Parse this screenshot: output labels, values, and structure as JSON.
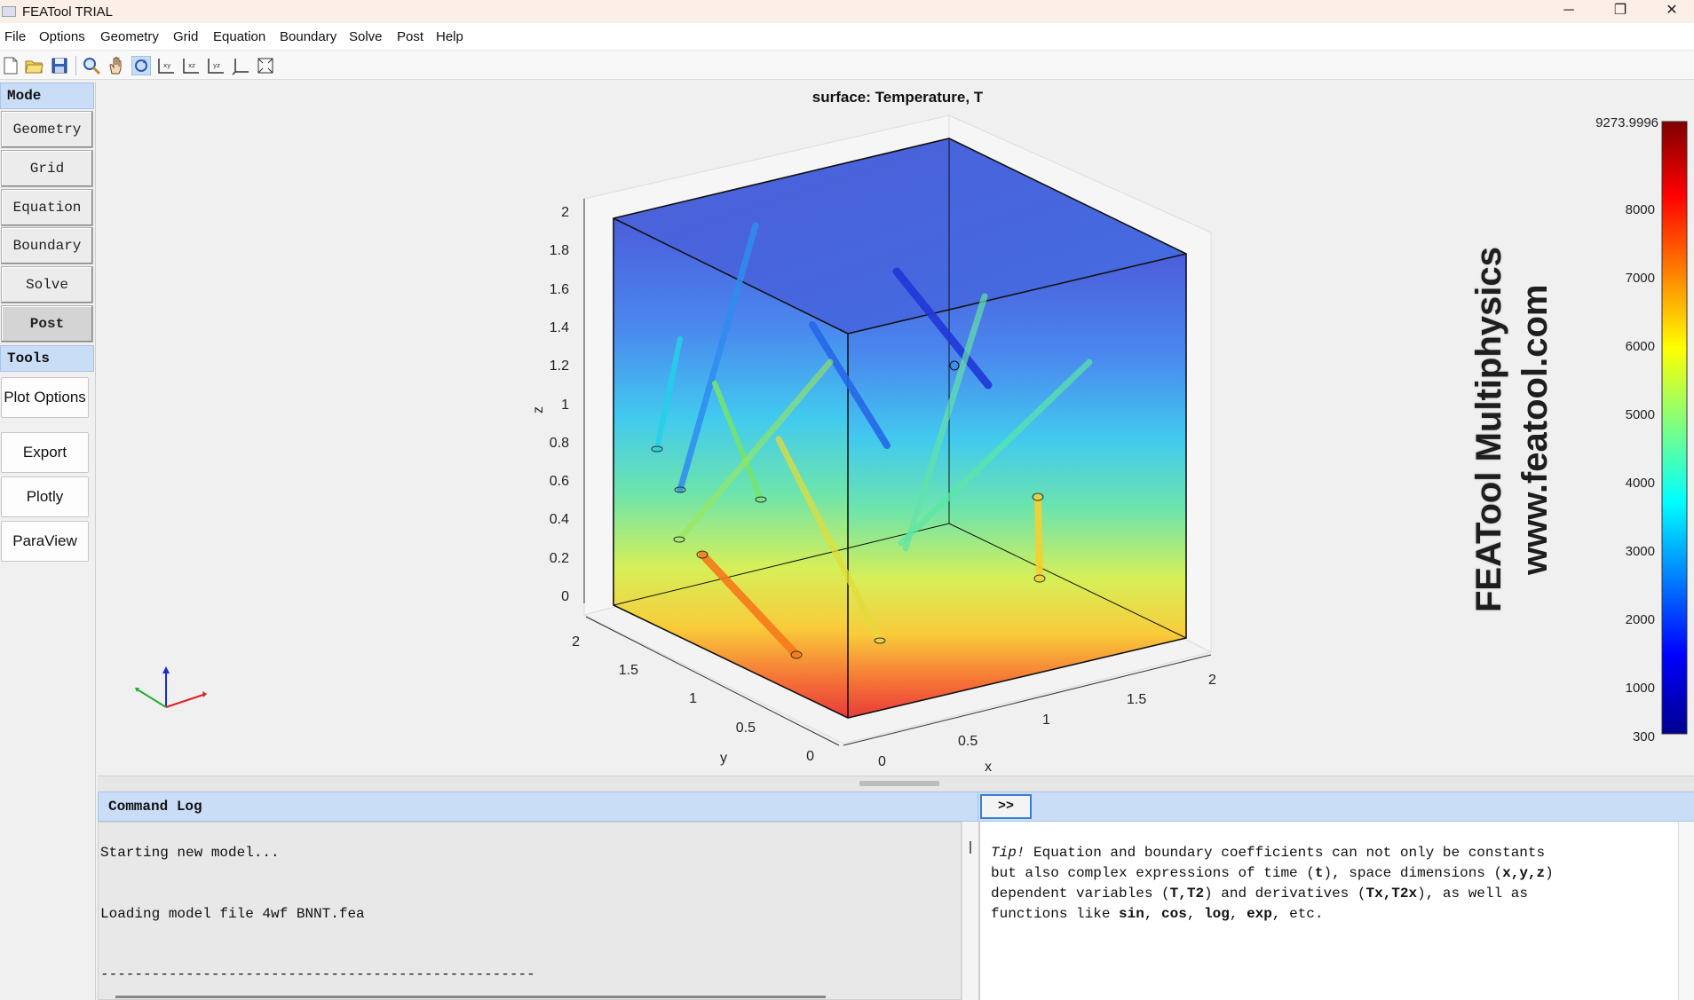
{
  "window": {
    "title": "FEATool TRIAL",
    "minimize": "─",
    "restore": "❐",
    "close": "✕"
  },
  "menu": [
    "File",
    "Options",
    "Geometry",
    "Grid",
    "Equation",
    "Boundary",
    "Solve",
    "Post",
    "Help"
  ],
  "toolbar": {
    "icons": [
      "new-file-icon",
      "open-folder-icon",
      "save-icon",
      "zoom-icon",
      "pan-hand-icon",
      "rotate-icon",
      "view-xy-icon",
      "view-xz-icon",
      "view-yz-icon",
      "axes-3d-icon",
      "fit-view-icon"
    ]
  },
  "sidebar": {
    "mode_header": "Mode",
    "modes": [
      "Geometry",
      "Grid",
      "Equation",
      "Boundary",
      "Solve",
      "Post"
    ],
    "active_mode": "Post",
    "tools_header": "Tools",
    "tools": [
      "Plot Options",
      "Export",
      "Plotly",
      "ParaView"
    ]
  },
  "plot": {
    "title": "surface: Temperature, T",
    "watermark_line1": "FEATool Multiphysics",
    "watermark_line2": "www.featool.com",
    "z_axis_label": "z",
    "y_axis_label": "y",
    "x_axis_label": "x",
    "z_ticks": [
      "2",
      "1.8",
      "1.6",
      "1.4",
      "1.2",
      "1",
      "0.8",
      "0.6",
      "0.4",
      "0.2",
      "0"
    ],
    "y_ticks": [
      "2",
      "1.5",
      "1",
      "0.5",
      "0"
    ],
    "x_ticks": [
      "0",
      "0.5",
      "1",
      "1.5",
      "2"
    ],
    "colorbar_labels": [
      "9273.9996",
      "8000",
      "7000",
      "6000",
      "5000",
      "4000",
      "3000",
      "2000",
      "1000",
      "300"
    ],
    "colorbar_max": 9273.9996,
    "colorbar_min": 300
  },
  "log": {
    "header": "Command Log",
    "toggle_label": ">>",
    "lines": [
      "Starting new model...",
      "Loading model file 4wf BNNT.fea",
      "---------------------------------------------------"
    ]
  },
  "tip": {
    "label": "Tip!",
    "line1": " Equation and boundary coefficients can not only be constants",
    "line2a": "but also complex expressions of time (",
    "t": "t",
    "line2b": "), space dimensions (",
    "xyz": "x,y,z",
    "line2c": ")",
    "line3a": "dependent variables (",
    "vars": "T,T2",
    "line3b": ") and derivatives (",
    "derivs": "Tx,T2x",
    "line3c": "), as well as",
    "line4a": "functions like ",
    "sin": "sin",
    "c1": ", ",
    "cos": "cos",
    "c2": ", ",
    "log": "log",
    "c3": ", ",
    "exp": "exp",
    "line4b": ", etc."
  }
}
